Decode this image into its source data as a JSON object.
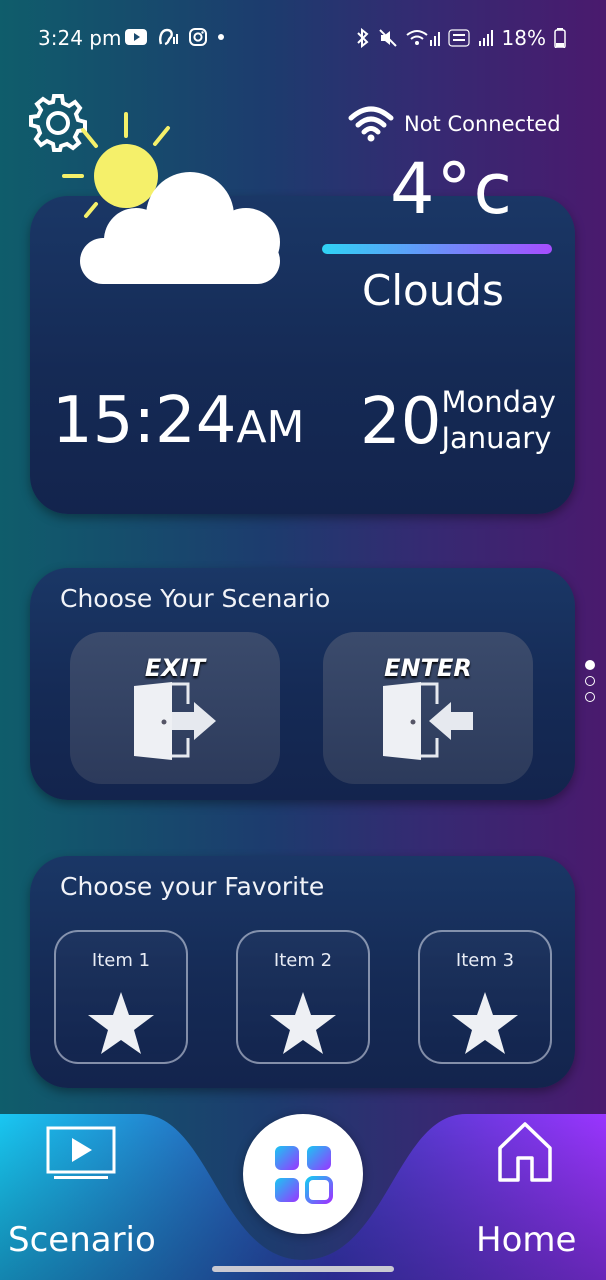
{
  "status_bar": {
    "time": "3:24 pm",
    "battery": "18%"
  },
  "weather": {
    "connection": "Not Connected",
    "temperature": "4°c",
    "condition": "Clouds",
    "clock": "15:24",
    "meridiem": "AM",
    "day_number": "20",
    "weekday": "Monday",
    "month": "January"
  },
  "scenario": {
    "title": "Choose Your Scenario",
    "exit_label": "EXIT",
    "enter_label": "ENTER"
  },
  "favorites": {
    "title": "Choose your Favorite",
    "items": [
      {
        "label": "Item 1"
      },
      {
        "label": "Item 2"
      },
      {
        "label": "Item 3"
      }
    ]
  },
  "bottom_nav": {
    "left_label": "Scenario",
    "right_label": "Home"
  },
  "colors": {
    "bar_gradient_start": "#2fd3f5",
    "bar_gradient_end": "#a64dff",
    "nav_left": "#19c7f2",
    "nav_right": "#9a35ff"
  }
}
